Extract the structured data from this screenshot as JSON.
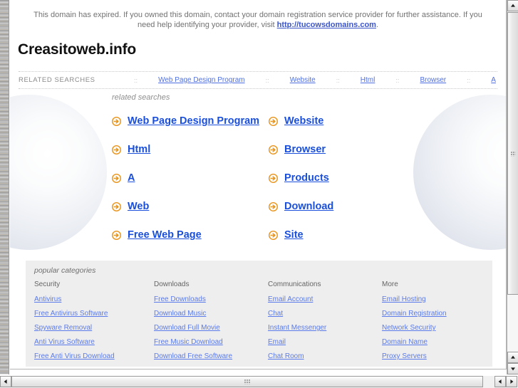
{
  "notice": {
    "text_before": "This domain has expired. If you owned this domain, contact your domain registration service provider for further assistance. If you need help identifying your provider, visit ",
    "link_text": "http://tucowsdomains.com",
    "text_after": "."
  },
  "domain_title": "Creasitoweb.info",
  "related_strip": {
    "label": "RELATED SEARCHES",
    "separator": "::",
    "links": [
      "Web Page Design Program",
      "Website",
      "Html",
      "Browser",
      "A"
    ]
  },
  "hero": {
    "heading": "related searches",
    "arrow_icon": "arrow-circle-right-icon",
    "links_left": [
      "Web Page Design Program",
      "Html",
      "A",
      "Web",
      "Free Web Page"
    ],
    "links_right": [
      "Website",
      "Browser",
      "Products",
      "Download",
      "Site"
    ]
  },
  "popular": {
    "heading": "popular categories",
    "columns": [
      {
        "title": "Security",
        "links": [
          "Antivirus",
          "Free Antivirus Software",
          "Spyware Removal",
          "Anti Virus Software",
          "Free Anti Virus Download"
        ]
      },
      {
        "title": "Downloads",
        "links": [
          "Free Downloads",
          "Download Music",
          "Download Full Movie",
          "Free Music Download",
          "Download Free Software"
        ]
      },
      {
        "title": "Communications",
        "links": [
          "Email Account",
          "Chat",
          "Instant Messenger",
          "Email",
          "Chat Room"
        ]
      },
      {
        "title": "More",
        "links": [
          "Email Hosting",
          "Domain Registration",
          "Network Security",
          "Domain Name",
          "Proxy Servers"
        ]
      }
    ]
  },
  "colors": {
    "link_blue": "#1a4fdc",
    "strip_link_blue": "#4f6fe0",
    "category_link_blue": "#5b7bea",
    "arrow_orange": "#e8941a",
    "panel_gray": "#eeeeee",
    "notice_gray": "#727272"
  },
  "scrollbars": {
    "vertical_up": "scroll-up-arrow",
    "vertical_down": "scroll-down-arrow",
    "horizontal_left": "scroll-left-arrow",
    "horizontal_right": "scroll-right-arrow"
  }
}
